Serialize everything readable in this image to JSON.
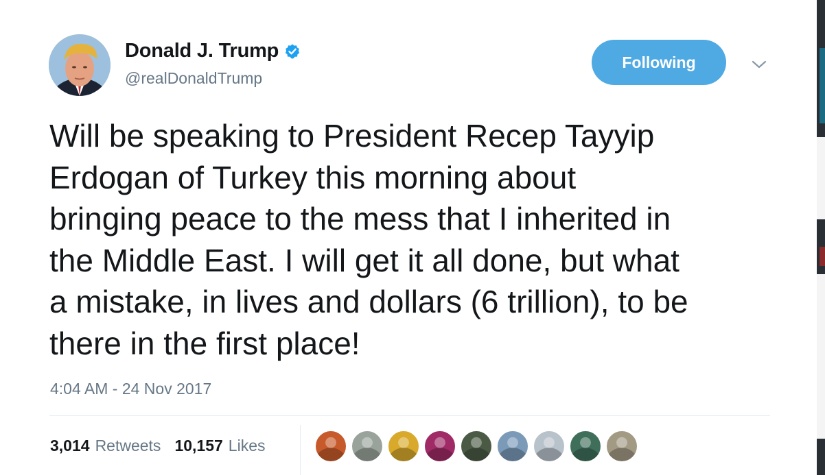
{
  "author": {
    "display_name": "Donald J. Trump",
    "handle": "@realDonaldTrump",
    "verified": true
  },
  "follow_button": {
    "label": "Following"
  },
  "tweet": {
    "text": "Will be speaking to President Recep Tayyip\nErdogan of Turkey this morning about\nbringing peace to the mess that I inherited in\nthe Middle East. I will get it all done, but what\na mistake, in lives and dollars (6 trillion), to be\nthere in the first place!",
    "timestamp": "4:04 AM - 24 Nov 2017"
  },
  "stats": {
    "retweets_count": "3,014",
    "retweets_label": "Retweets",
    "likes_count": "10,157",
    "likes_label": "Likes"
  },
  "icons": {
    "verified": "verified-badge-icon",
    "menu": "chevron-down-icon"
  },
  "colors": {
    "accent": "#4fa9e3",
    "text_primary": "#14171a",
    "text_secondary": "#657786",
    "divider": "#e6ecf0"
  },
  "liker_avatars": [
    {
      "color": "#c75a2a"
    },
    {
      "color": "#9aa39b"
    },
    {
      "color": "#d8a92a"
    },
    {
      "color": "#a02a66"
    },
    {
      "color": "#4b5a44"
    },
    {
      "color": "#7a9ab8"
    },
    {
      "color": "#b8c2cb"
    },
    {
      "color": "#3f6f5a"
    },
    {
      "color": "#a39a84"
    }
  ]
}
